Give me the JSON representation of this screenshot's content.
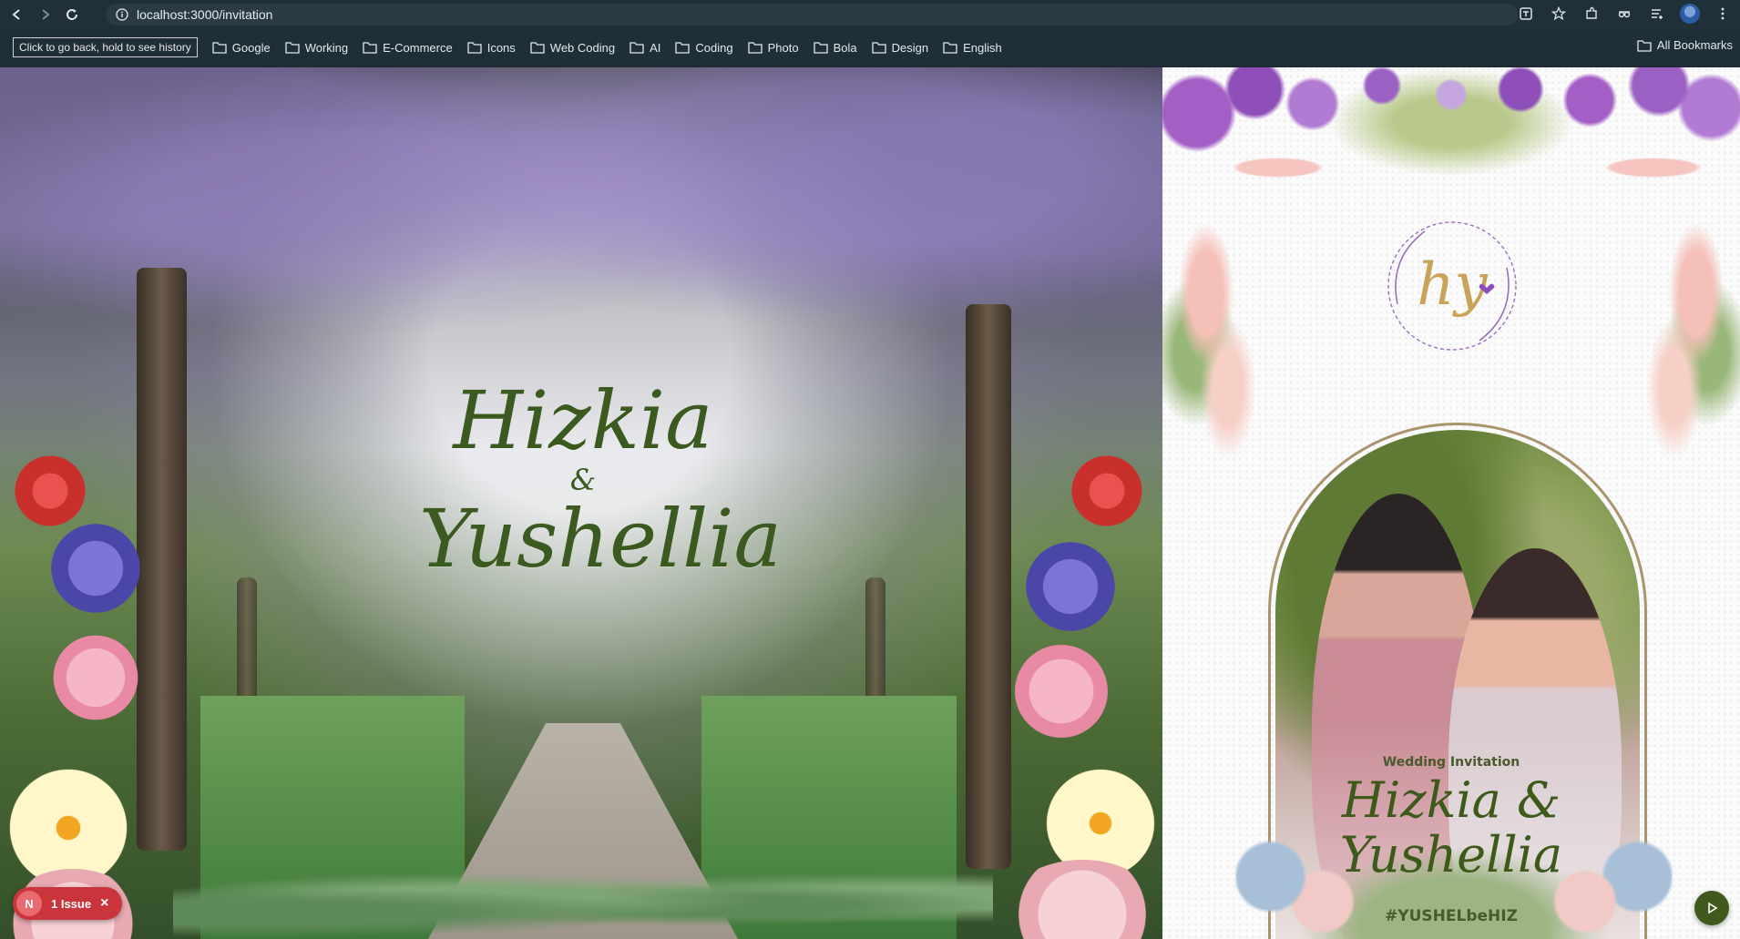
{
  "browser": {
    "url": "localhost:3000/invitation",
    "tooltip": "Click to go back, hold to see history",
    "bookmarks": [
      "Google",
      "Working",
      "E-Commerce",
      "Icons",
      "Web Coding",
      "AI",
      "Coding",
      "Photo",
      "Bola",
      "Design",
      "English"
    ],
    "all_bookmarks": "All Bookmarks"
  },
  "hero": {
    "name1": "Hizkia",
    "amp": "&",
    "name2": "Yushellia"
  },
  "card": {
    "monogram": "hy",
    "label": "Wedding Invitation",
    "names_line1": "Hizkia &",
    "names_line2": "Yushellia",
    "hashtag": "#YUSHELbeHIZ"
  },
  "widgets": {
    "issue_initial": "N",
    "issue_label": "1 Issue",
    "issue_close": "×"
  },
  "colors": {
    "topbar": "#203038",
    "script_green": "#3b5a1f",
    "issue_red": "#c9353b",
    "play_green": "#3f5a1c"
  },
  "icons": [
    "back-arrow-icon",
    "forward-arrow-icon",
    "reload-icon",
    "site-info-icon",
    "translate-icon",
    "star-icon",
    "extensions-icon",
    "tab-search-icon",
    "reading-list-icon",
    "avatar",
    "menu-icon",
    "folder-icon",
    "play-icon",
    "close-icon"
  ]
}
